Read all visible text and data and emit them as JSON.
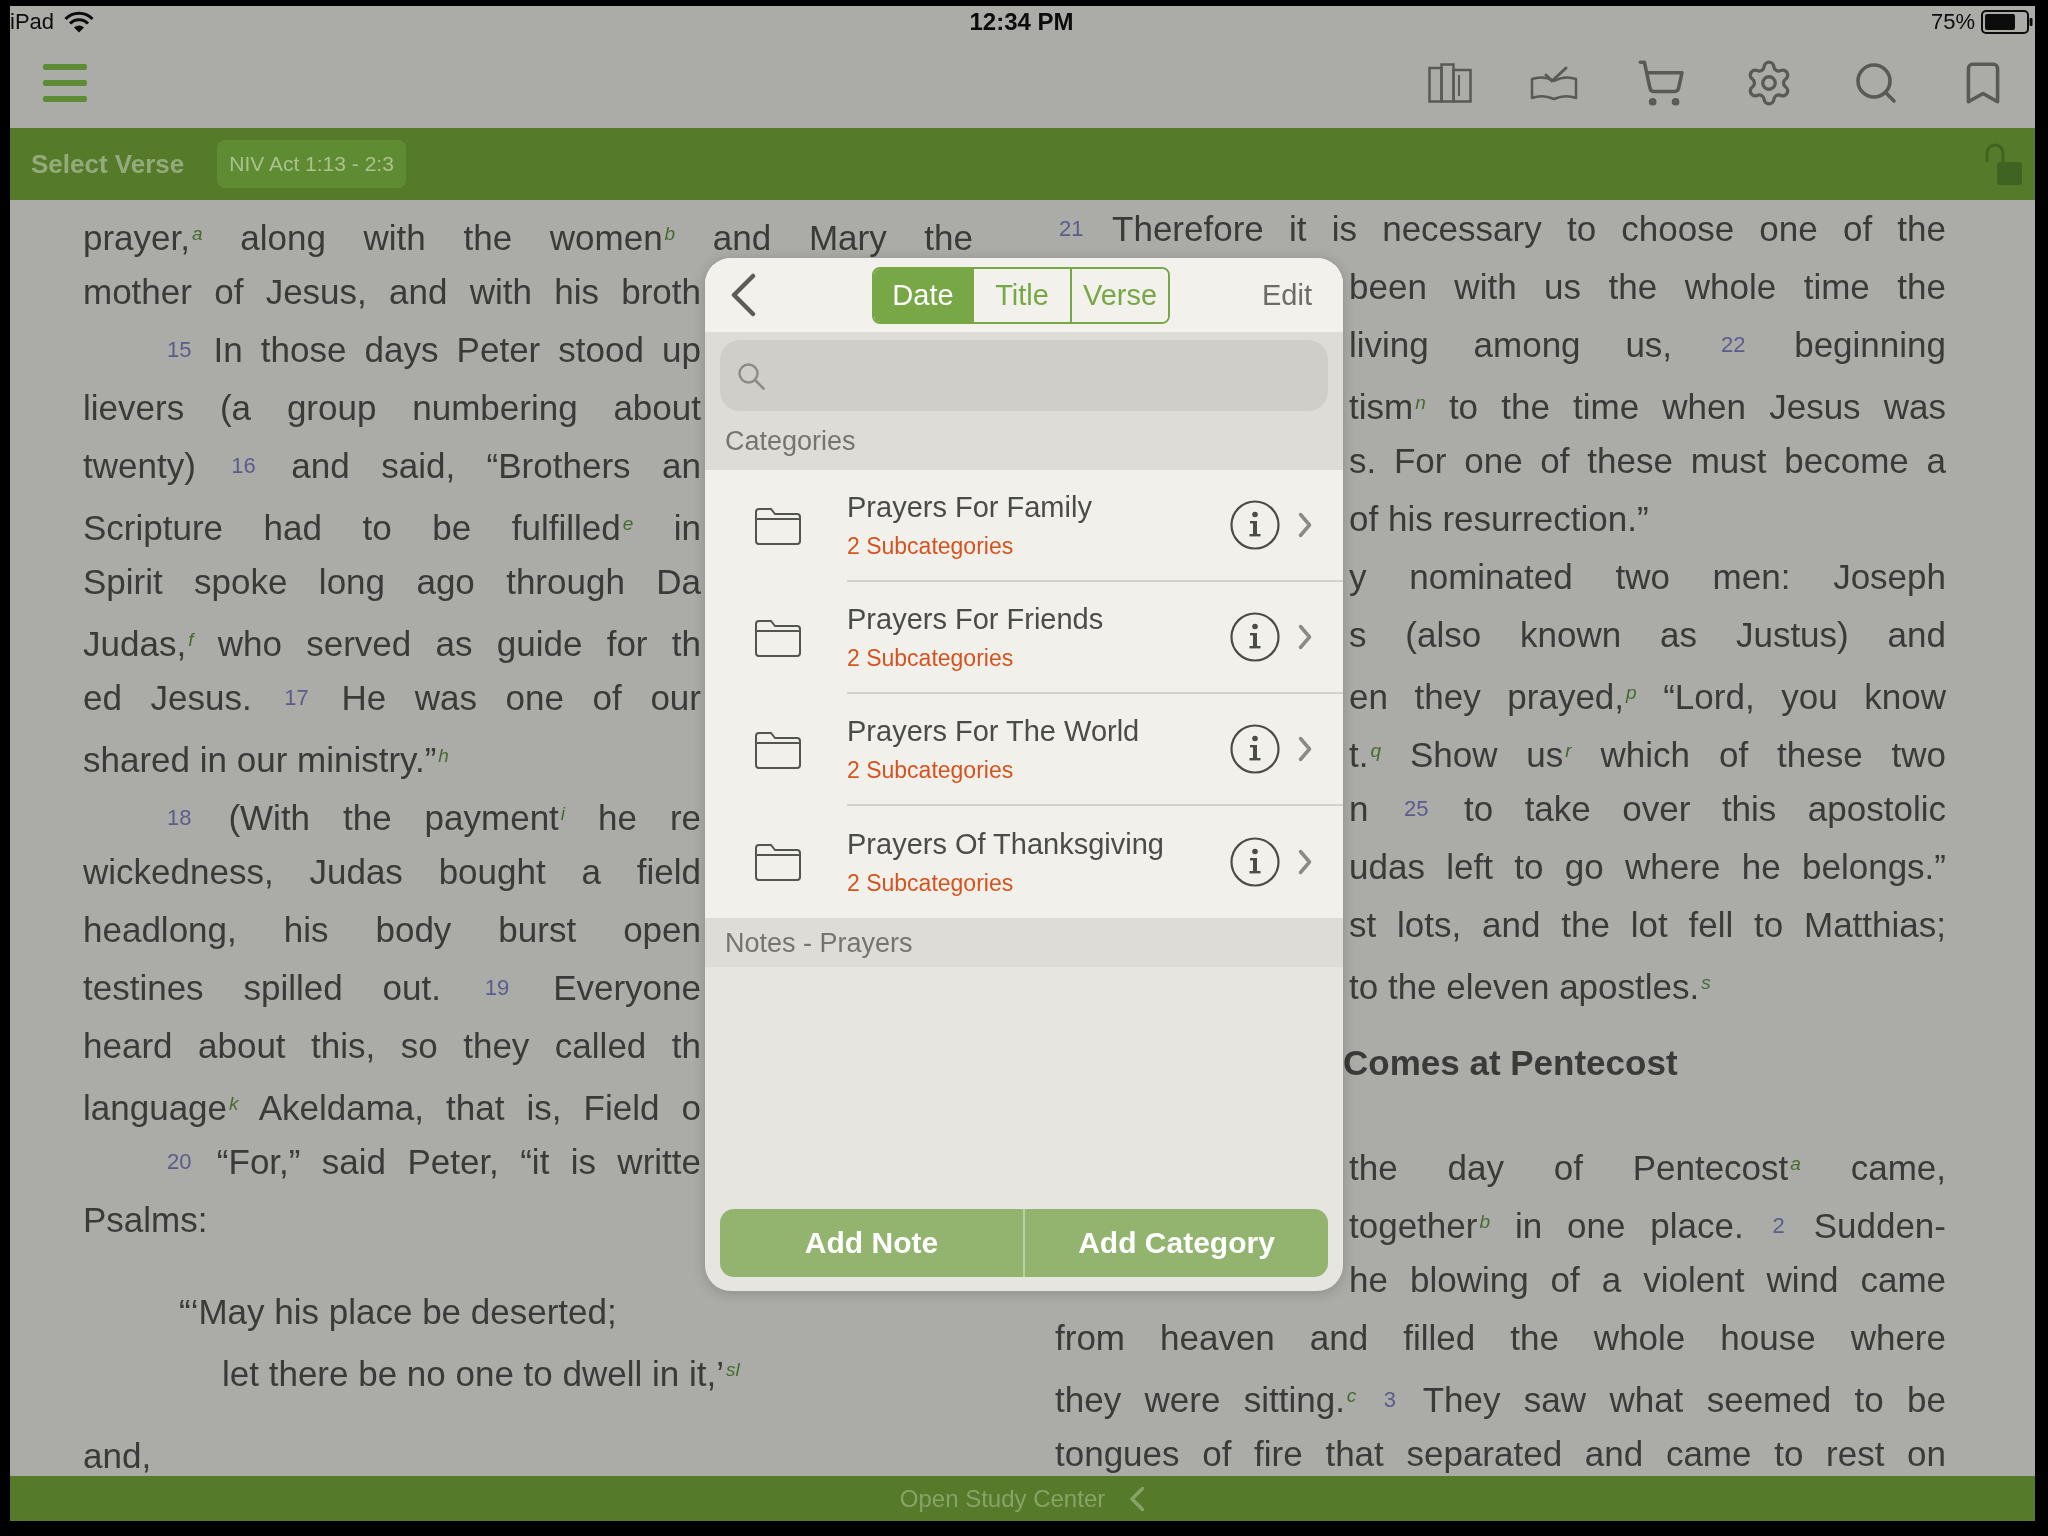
{
  "status_bar": {
    "device": "iPad",
    "time": "12:34 PM",
    "battery": "75%"
  },
  "verse_bar": {
    "label": "Select Verse",
    "reference": "NIV Act 1:13 - 2:3"
  },
  "reader": {
    "left_column": [
      {
        "kind": "middle",
        "parts": [
          {
            "kind": "text",
            "text": "prayer,"
          },
          {
            "kind": "note",
            "text": "a"
          },
          {
            "kind": "text",
            "text": " along with the women"
          },
          {
            "kind": "note",
            "text": "b"
          },
          {
            "kind": "text",
            "text": " and Mary the"
          }
        ]
      },
      {
        "kind": "middle",
        "parts": [
          {
            "kind": "text",
            "text": "mother of Jesus, and with his broth"
          }
        ]
      },
      {
        "kind": "first",
        "parts": [
          {
            "kind": "verse",
            "text": "15"
          },
          {
            "kind": "text",
            "text": "In those days Peter stood up"
          }
        ]
      },
      {
        "kind": "middle",
        "parts": [
          {
            "kind": "text",
            "text": "lievers (a group numbering about"
          }
        ]
      },
      {
        "kind": "middle",
        "parts": [
          {
            "kind": "text",
            "text": "twenty)"
          },
          {
            "kind": "verse",
            "text": "16"
          },
          {
            "kind": "text",
            "text": "and said, “Brothers an"
          }
        ]
      },
      {
        "kind": "middle",
        "parts": [
          {
            "kind": "text",
            "text": "Scripture had to be fulfilled"
          },
          {
            "kind": "note",
            "text": "e"
          },
          {
            "kind": "text",
            "text": " in"
          }
        ]
      },
      {
        "kind": "middle",
        "parts": [
          {
            "kind": "text",
            "text": "Spirit spoke long ago through Da"
          }
        ]
      },
      {
        "kind": "middle",
        "parts": [
          {
            "kind": "text",
            "text": "Judas,"
          },
          {
            "kind": "note",
            "text": "f"
          },
          {
            "kind": "text",
            "text": " who served as guide for th"
          }
        ]
      },
      {
        "kind": "middle",
        "parts": [
          {
            "kind": "text",
            "text": "ed Jesus."
          },
          {
            "kind": "verse",
            "text": "17"
          },
          {
            "kind": "text",
            "text": "He was one of our"
          }
        ]
      },
      {
        "kind": "last",
        "parts": [
          {
            "kind": "text",
            "text": "shared in our ministry.”"
          },
          {
            "kind": "note",
            "text": "h"
          }
        ]
      },
      {
        "kind": "first",
        "parts": [
          {
            "kind": "verse",
            "text": "18"
          },
          {
            "kind": "text",
            "text": "(With the payment"
          },
          {
            "kind": "note",
            "text": "i"
          },
          {
            "kind": "text",
            "text": " he re"
          }
        ]
      },
      {
        "kind": "middle",
        "parts": [
          {
            "kind": "text",
            "text": "wickedness, Judas bought a field"
          }
        ]
      },
      {
        "kind": "middle",
        "parts": [
          {
            "kind": "text",
            "text": "headlong, his body burst open"
          }
        ]
      },
      {
        "kind": "middle",
        "parts": [
          {
            "kind": "text",
            "text": "testines spilled out."
          },
          {
            "kind": "verse",
            "text": "19"
          },
          {
            "kind": "text",
            "text": "Everyone"
          }
        ]
      },
      {
        "kind": "middle",
        "parts": [
          {
            "kind": "text",
            "text": "heard about this, so they called th"
          }
        ]
      },
      {
        "kind": "middle",
        "parts": [
          {
            "kind": "text",
            "text": "language"
          },
          {
            "kind": "note",
            "text": "k"
          },
          {
            "kind": "text",
            "text": " Akeldama, that is, Field o"
          }
        ]
      },
      {
        "kind": "first",
        "parts": [
          {
            "kind": "verse",
            "text": "20"
          },
          {
            "kind": "text",
            "text": "“For,” said Peter, “it is writte"
          }
        ]
      },
      {
        "kind": "last",
        "parts": [
          {
            "kind": "text",
            "text": "Psalms:"
          }
        ]
      },
      {
        "kind": "poem",
        "parts": [
          {
            "kind": "text",
            "text": "“‘May his place be deserted;"
          }
        ]
      },
      {
        "kind": "poem-turn",
        "parts": [
          {
            "kind": "text",
            "text": "let there be no one to dwell in it,’"
          },
          {
            "kind": "note",
            "text": "sl"
          }
        ]
      },
      {
        "kind": "last",
        "parts": [
          {
            "kind": "text",
            "text": "and,"
          }
        ]
      }
    ],
    "right_column": [
      {
        "kind": "middle",
        "parts": [
          {
            "kind": "verse",
            "text": "21"
          },
          {
            "kind": "text",
            "text": "Therefore it is necessary to choose one of the"
          }
        ]
      },
      {
        "kind": "middle",
        "parts": [
          {
            "kind": "text",
            "text": "been with us the whole time the"
          }
        ]
      },
      {
        "kind": "middle",
        "parts": [
          {
            "kind": "text",
            "text": "living among us,"
          },
          {
            "kind": "verse",
            "text": "22"
          },
          {
            "kind": "text",
            "text": "beginning"
          }
        ]
      },
      {
        "kind": "middle",
        "parts": [
          {
            "kind": "text",
            "text": "tism"
          },
          {
            "kind": "note",
            "text": "n"
          },
          {
            "kind": "text",
            "text": " to the time when Jesus was"
          }
        ]
      },
      {
        "kind": "middle",
        "parts": [
          {
            "kind": "text",
            "text": "s. For one of these must become a"
          }
        ]
      },
      {
        "kind": "last",
        "parts": [
          {
            "kind": "text",
            "text": "of his resurrection.”"
          }
        ]
      },
      {
        "kind": "middle",
        "parts": [
          {
            "kind": "text",
            "text": "y nominated two men: Joseph"
          }
        ]
      },
      {
        "kind": "middle",
        "parts": [
          {
            "kind": "text",
            "text": "s (also known as Justus) and"
          }
        ]
      },
      {
        "kind": "middle",
        "parts": [
          {
            "kind": "text",
            "text": "en they prayed,"
          },
          {
            "kind": "note",
            "text": "p"
          },
          {
            "kind": "text",
            "text": " “Lord, you know"
          }
        ]
      },
      {
        "kind": "middle",
        "parts": [
          {
            "kind": "text",
            "text": "t."
          },
          {
            "kind": "note",
            "text": "q"
          },
          {
            "kind": "text",
            "text": " Show us"
          },
          {
            "kind": "note",
            "text": "r"
          },
          {
            "kind": "text",
            "text": " which of these two"
          }
        ]
      },
      {
        "kind": "middle",
        "parts": [
          {
            "kind": "text",
            "text": "n"
          },
          {
            "kind": "verse",
            "text": "25"
          },
          {
            "kind": "text",
            "text": "to take over this apostolic"
          }
        ]
      },
      {
        "kind": "middle",
        "parts": [
          {
            "kind": "text",
            "text": "udas left to go where he belongs.”"
          }
        ]
      },
      {
        "kind": "middle",
        "parts": [
          {
            "kind": "text",
            "text": "st lots, and the lot fell to Matthias;"
          }
        ]
      },
      {
        "kind": "last",
        "parts": [
          {
            "kind": "text",
            "text": "to the eleven apostles."
          },
          {
            "kind": "note",
            "text": "s"
          }
        ]
      },
      {
        "kind": "heading",
        "parts": [
          {
            "kind": "text",
            "text": "Comes at Pentecost"
          }
        ]
      },
      {
        "kind": "middle",
        "parts": [
          {
            "kind": "text",
            "text": "the day of Pentecost"
          },
          {
            "kind": "note",
            "text": "a"
          },
          {
            "kind": "text",
            "text": " came,"
          }
        ]
      },
      {
        "kind": "middle",
        "parts": [
          {
            "kind": "text",
            "text": "together"
          },
          {
            "kind": "note",
            "text": "b"
          },
          {
            "kind": "text",
            "text": " in one place."
          },
          {
            "kind": "verse",
            "text": "2"
          },
          {
            "kind": "text",
            "text": "Sudden-"
          }
        ]
      },
      {
        "kind": "middle",
        "parts": [
          {
            "kind": "text",
            "text": "he blowing of a violent wind came"
          }
        ]
      },
      {
        "kind": "middle",
        "parts": [
          {
            "kind": "text",
            "text": "from heaven and filled the whole house where"
          }
        ]
      },
      {
        "kind": "middle",
        "parts": [
          {
            "kind": "text",
            "text": "they were sitting."
          },
          {
            "kind": "note",
            "text": "c"
          },
          {
            "kind": "verse",
            "text": "3"
          },
          {
            "kind": "text",
            "text": "They saw what seemed to be"
          }
        ]
      },
      {
        "kind": "middle",
        "parts": [
          {
            "kind": "text",
            "text": "tongues of fire that separated and came to rest on"
          }
        ]
      }
    ]
  },
  "dialog": {
    "tabs": [
      {
        "label": "Date",
        "selected": true
      },
      {
        "label": "Title",
        "selected": false
      },
      {
        "label": "Verse",
        "selected": false
      }
    ],
    "edit": "Edit",
    "categories_label": "Categories",
    "categories": [
      {
        "title": "Prayers For Family",
        "subtitle": "2 Subcategories"
      },
      {
        "title": "Prayers For Friends",
        "subtitle": "2 Subcategories"
      },
      {
        "title": "Prayers For The World",
        "subtitle": "2 Subcategories"
      },
      {
        "title": "Prayers Of Thanksgiving",
        "subtitle": "2 Subcategories"
      }
    ],
    "notes_label": "Notes - Prayers",
    "buttons": [
      "Add Note",
      "Add Category"
    ]
  },
  "bottom_bar": {
    "label": "Open Study Center"
  }
}
